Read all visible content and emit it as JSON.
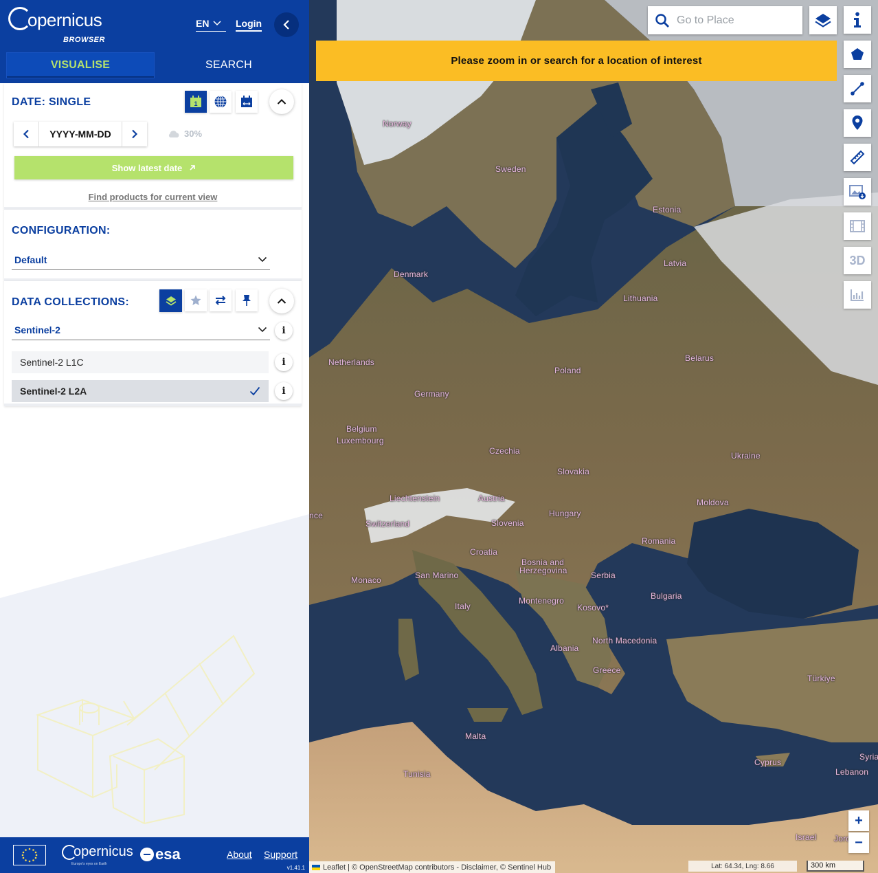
{
  "header": {
    "logo_text": "opernicus",
    "logo_sub": "BROWSER",
    "language": "EN",
    "login_label": "Login",
    "tabs": [
      {
        "label": "VISUALISE",
        "active": true
      },
      {
        "label": "SEARCH",
        "active": false
      }
    ]
  },
  "date_panel": {
    "title": "DATE: SINGLE",
    "date_value": "YYYY-MM-DD",
    "cloud_cover": "30%",
    "latest_button": "Show latest date",
    "find_products": "Find products for current view",
    "mode_icons": [
      "calendar-single-icon",
      "globe-icon",
      "calendar-range-icon"
    ],
    "calendar_badge": "1"
  },
  "config_panel": {
    "title": "CONFIGURATION:",
    "selected": "Default"
  },
  "collections_panel": {
    "title": "DATA COLLECTIONS:",
    "selected": "Sentinel-2",
    "items": [
      {
        "label": "Sentinel-2 L1C",
        "selected": false
      },
      {
        "label": "Sentinel-2 L2A",
        "selected": true
      }
    ]
  },
  "footer": {
    "partner_logo": "opernicus",
    "partner_sub": "Europe's eyes on Earth",
    "esa": "esa",
    "about": "About",
    "support": "Support",
    "version": "v1.41.1"
  },
  "map": {
    "search_placeholder": "Go to Place",
    "banner": "Please zoom in or search for a location of interest",
    "tools": [
      "info-icon",
      "polygon-icon",
      "line-icon",
      "marker-icon",
      "ruler-icon",
      "image-download-icon",
      "timelapse-icon",
      "3d-icon",
      "chart-icon"
    ],
    "tool_3d_label": "3D",
    "zoom_in": "+",
    "zoom_out": "−",
    "attribution": "Leaflet | © OpenStreetMap contributors - Disclaimer, © Sentinel Hub",
    "coords": "Lat: 64.34, Lng: 8.66",
    "scale": "300 km",
    "labels": [
      "Norway",
      "Sweden",
      "Estonia",
      "Latvia",
      "Denmark",
      "Lithuania",
      "Netherlands",
      "Belarus",
      "Poland",
      "Germany",
      "Belgium",
      "Luxembourg",
      "Czechia",
      "Ukraine",
      "Slovakia",
      "Liechtenstein",
      "Austria",
      "Moldova",
      "Hungary",
      "nce",
      "Switzerland",
      "Slovenia",
      "Romania",
      "Croatia",
      "Bosnia and",
      "Herzegovina",
      "Serbia",
      "San Marino",
      "Monaco",
      "Bulgaria",
      "Montenegro",
      "Kosovo*",
      "Italy",
      "North Macedonia",
      "Albania",
      "Greece",
      "Türkiye",
      "Malta",
      "Syria",
      "Cyprus",
      "Tunisia",
      "Lebanon",
      "Israel",
      "Jord"
    ],
    "colors": {
      "brand": "#0b3fa0",
      "accent": "#b5e26c",
      "banner": "#fbbd24"
    }
  }
}
